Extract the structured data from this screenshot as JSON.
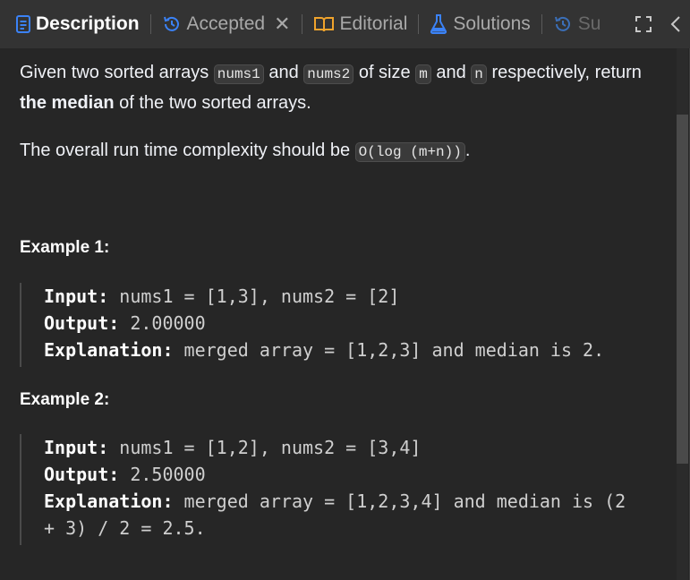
{
  "tabs": {
    "description": "Description",
    "accepted": "Accepted",
    "editorial": "Editorial",
    "solutions": "Solutions",
    "submissions_partial": "Su"
  },
  "problem": {
    "p1_a": "Given two sorted arrays ",
    "p1_code1": "nums1",
    "p1_b": " and ",
    "p1_code2": "nums2",
    "p1_c": " of size ",
    "p1_code3": "m",
    "p1_d": " and ",
    "p1_code4": "n",
    "p1_e": " respectively, return ",
    "p1_bold": "the median",
    "p1_f": " of the two sorted arrays.",
    "p2_a": "The overall run time complexity should be ",
    "p2_code": "O(log (m+n))",
    "p2_b": "."
  },
  "examples": [
    {
      "title": "Example 1:",
      "input_label": "Input:",
      "input": " nums1 = [1,3], nums2 = [2]",
      "output_label": "Output:",
      "output": " 2.00000",
      "explanation_label": "Explanation:",
      "explanation": " merged array = [1,2,3] and median is 2."
    },
    {
      "title": "Example 2:",
      "input_label": "Input:",
      "input": " nums1 = [1,2], nums2 = [3,4]",
      "output_label": "Output:",
      "output": " 2.50000",
      "explanation_label": "Explanation:",
      "explanation_line1": " merged array = [1,2,3,4] and median is (2",
      "explanation_line2": "+ 3) / 2 = 2.5."
    }
  ],
  "colors": {
    "background": "#262626",
    "tabbar": "#333333",
    "description_icon": "#3b82f6",
    "accepted_icon": "#3b82f6",
    "editorial_icon": "#f0a32c",
    "solutions_icon": "#3b82f6"
  }
}
